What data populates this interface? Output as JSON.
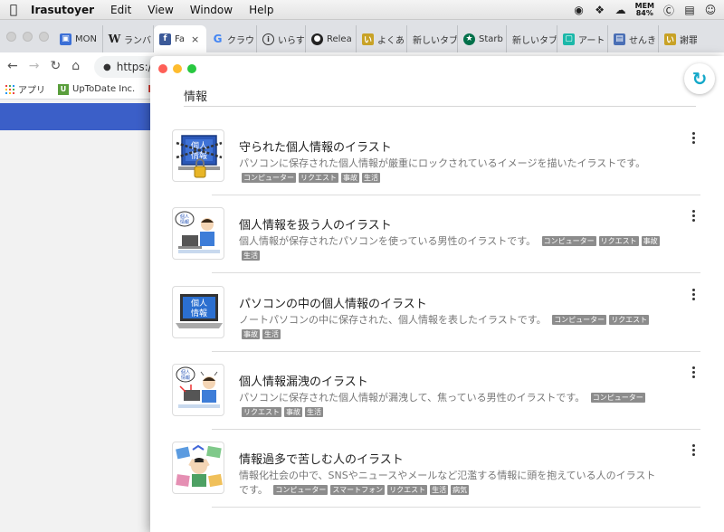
{
  "menubar": {
    "app_name": "Irasutoyer",
    "menus": [
      "Edit",
      "View",
      "Window",
      "Help"
    ],
    "mem_label": "MEM",
    "mem_value": "84%"
  },
  "browser": {
    "tabs": [
      {
        "label": "MON",
        "favicon": "mon-icon",
        "color": "#3b6fd6"
      },
      {
        "label": "ランバ",
        "favicon": "wikipedia-icon",
        "color": "#ffffff"
      },
      {
        "label": "Fa",
        "favicon": "facebook-icon",
        "color": "#3b5998"
      },
      {
        "label": "クラウ",
        "favicon": "google-icon",
        "color": "#ffffff"
      },
      {
        "label": "いらす",
        "favicon": "info-icon",
        "color": "#ffffff"
      },
      {
        "label": "Relea",
        "favicon": "github-icon",
        "color": "#ffffff"
      },
      {
        "label": "よくあ",
        "favicon": "irasutoya-icon",
        "color": "#c8a226"
      },
      {
        "label": "新しいタブ",
        "favicon": "",
        "color": ""
      },
      {
        "label": "Starb",
        "favicon": "starbucks-icon",
        "color": "#00704a"
      },
      {
        "label": "新しいタブ",
        "favicon": "",
        "color": ""
      },
      {
        "label": "アート",
        "favicon": "art-icon",
        "color": "#1bb8a9"
      },
      {
        "label": "せんき",
        "favicon": "doc-icon",
        "color": "#4a6fb5"
      },
      {
        "label": "謝罪を",
        "favicon": "irasutoya-icon",
        "color": "#c8a226"
      }
    ],
    "active_tab_close": "×",
    "url": "https:/",
    "bookmarks": [
      {
        "label": "アプリ"
      },
      {
        "label": "UpToDate Inc."
      }
    ]
  },
  "popup": {
    "heading": "情報",
    "items": [
      {
        "title": "守られた個人情報のイラスト",
        "description": "パソコンに保存された個人情報が厳重にロックされているイメージを描いたイラストです。",
        "tags": [
          "コンピューター",
          "リクエスト",
          "事故",
          "生活"
        ],
        "thumb_icon": "locked-personal-info-icon"
      },
      {
        "title": "個人情報を扱う人のイラスト",
        "description": "個人情報が保存されたパソコンを使っている男性のイラストです。",
        "tags": [
          "コンピューター",
          "リクエスト",
          "事故",
          "生活"
        ],
        "thumb_icon": "man-with-laptop-icon"
      },
      {
        "title": "パソコンの中の個人情報のイラスト",
        "description": "ノートパソコンの中に保存された、個人情報を表したイラストです。",
        "tags": [
          "コンピューター",
          "リクエスト",
          "事故",
          "生活"
        ],
        "thumb_icon": "laptop-personal-info-icon"
      },
      {
        "title": "個人情報漏洩のイラスト",
        "description": "パソコンに保存された個人情報が漏洩して、焦っている男性のイラストです。",
        "tags": [
          "コンピューター",
          "リクエスト",
          "事故",
          "生活"
        ],
        "thumb_icon": "info-leak-man-icon"
      },
      {
        "title": "情報過多で苦しむ人のイラスト",
        "description": "情報化社会の中で、SNSやニュースやメールなど氾濫する情報に頭を抱えている人のイラストです。",
        "tags": [
          "コンピューター",
          "スマートフォン",
          "リクエスト",
          "生活",
          "病気"
        ],
        "thumb_icon": "information-overload-icon"
      }
    ],
    "thumb_text": "個人\n情報"
  }
}
